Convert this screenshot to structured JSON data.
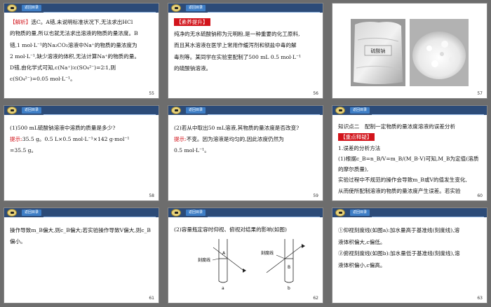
{
  "header_tab_label": "返回目录",
  "slides": {
    "s55": {
      "page": "55",
      "badge": "【解析】",
      "lines": [
        "选C。A错,未说明标准状况下,无法求出HCl",
        "的物质的量,所以也就无法求出溶液的物质的量浓度。B",
        "错,1 mol·L⁻¹的Na₂CO₃溶液中Na⁺的物质的量浓度为",
        "2 mol·L⁻¹,缺少溶液的体积,无法计算Na⁺的物质的量。",
        "D错,由化学式可知,c(Na⁺)∶c(SO₄²⁻)=2∶1,则",
        "c(SO₄²⁻)=0.05 mol·L⁻¹。"
      ]
    },
    "s56": {
      "page": "56",
      "badge": "【素养提升】",
      "lines": [
        "纯净的无水硫酸钠称为元明粉,是一种重要的化工原料,",
        "而且其水溶液在医学上常用作缓泻剂和钡盐中毒的解",
        "毒剂等。某同学在实验室配制了500 mL 0.5 mol·L⁻¹",
        "的硫酸钠溶液。"
      ]
    },
    "s57": {
      "page": "57",
      "bag_label": "硫酸钠"
    },
    "s58": {
      "page": "58",
      "question": "(1)500 mL硫酸钠溶液中溶质的质量是多少?",
      "hint_label": "提示:",
      "answer_1": "35.5 g。0.5 L×0.5 mol·L⁻¹×142 g·mol⁻¹",
      "answer_2": "=35.5 g。"
    },
    "s59": {
      "page": "59",
      "question": "(2)若从中取出50 mL溶液,其物质的量浓度是否改变?",
      "hint_label": "提示:",
      "answer_1": "不变。因为溶液是均匀的,因此浓度仍然为",
      "answer_2": "0.5 mol·L⁻¹。"
    },
    "s60": {
      "page": "60",
      "title": "知识点二　配制一定物质的量浓度溶液的误差分析",
      "badge": "【重点释疑】",
      "item1": "1.误差的分析方法",
      "lines": [
        "(1)根据c_B=n_B/V=m_B/(M_B·V)可知,M_B为定值(溶质的摩尔质量),",
        "实验过程中不规范的操作会导致m_B或V的值发生变化,",
        "从而使所配制溶液的物质的量浓度产生误差。若实验"
      ]
    },
    "s61": {
      "page": "61",
      "lines": [
        "操作导致m_B偏大,则c_B偏大;若实验操作导致V偏大,则c_B",
        "偏小。"
      ]
    },
    "s62": {
      "page": "62",
      "question": "(2)容量瓶定容时仰视、俯视对结果的影响(如图)",
      "scale_label": "刻度线",
      "label_a": "A",
      "label_b": "B",
      "caption_a": "a",
      "caption_b": "b"
    },
    "s63": {
      "page": "63",
      "lines": [
        "①仰视刻度线(如图a):加水量高于基准线(刻度线),溶",
        "液体积偏大,c偏低。",
        "②俯视刻度线(如图b):加水量低于基准线(刻度线),溶",
        "液体积偏小,c偏高。"
      ]
    }
  }
}
